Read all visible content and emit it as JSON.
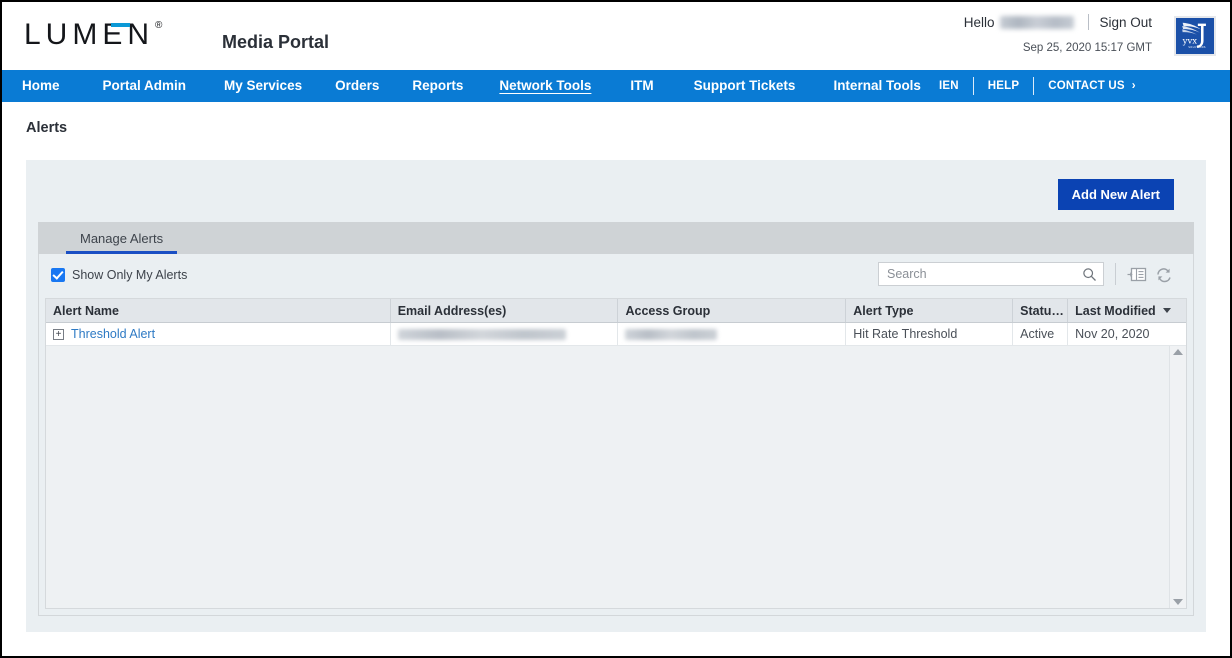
{
  "header": {
    "logo_text": "LUMEN",
    "logo_registered": "®",
    "portal_title": "Media Portal",
    "hello_label": "Hello",
    "username_masked": "",
    "sign_out": "Sign Out",
    "timestamp": "Sep 25, 2020 15:17 GMT",
    "brand_logo_alt": "Vyvx",
    "brand_logo_caption": "Vyvx",
    "accent_blue": "#0b99d6"
  },
  "nav": {
    "items": [
      {
        "label": "Home",
        "active": false
      },
      {
        "label": "Portal Admin",
        "active": false
      },
      {
        "label": "My Services",
        "active": false
      },
      {
        "label": "Orders",
        "active": false
      },
      {
        "label": "Reports",
        "active": false
      },
      {
        "label": "Network Tools",
        "active": true
      },
      {
        "label": "ITM",
        "active": false
      },
      {
        "label": "Support Tickets",
        "active": false
      },
      {
        "label": "Internal Tools",
        "active": false
      }
    ],
    "right_items": [
      {
        "label": "IEN"
      },
      {
        "label": "HELP"
      },
      {
        "label": "CONTACT US"
      }
    ],
    "chevron": "›",
    "bar_color": "#0a7bd4"
  },
  "page": {
    "title": "Alerts"
  },
  "toolbar": {
    "add_new_alert": "Add New Alert",
    "add_button_color": "#0b43b3"
  },
  "tabs": [
    {
      "label": "Manage Alerts",
      "active": true
    }
  ],
  "filters": {
    "show_only_my_alerts_label": "Show Only My Alerts",
    "show_only_my_alerts_checked": true,
    "search_placeholder": "Search",
    "search_value": "",
    "search_icon": "search-icon",
    "column_chooser_icon": "column-chooser-icon",
    "refresh_icon": "refresh-icon"
  },
  "grid": {
    "columns": [
      {
        "label": "Alert Name",
        "sorted": false
      },
      {
        "label": "Email Address(es)",
        "sorted": false
      },
      {
        "label": "Access Group",
        "sorted": false
      },
      {
        "label": "Alert Type",
        "sorted": false
      },
      {
        "label": "Statu…",
        "sorted": false
      },
      {
        "label": "Last Modified",
        "sorted": true,
        "sort_dir": "desc"
      }
    ],
    "rows": [
      {
        "expander": "+",
        "alert_name": "Threshold Alert",
        "email": "",
        "access_group": "",
        "alert_type": "Hit Rate Threshold",
        "status": "Active",
        "last_modified": "Nov 20, 2020"
      }
    ]
  }
}
